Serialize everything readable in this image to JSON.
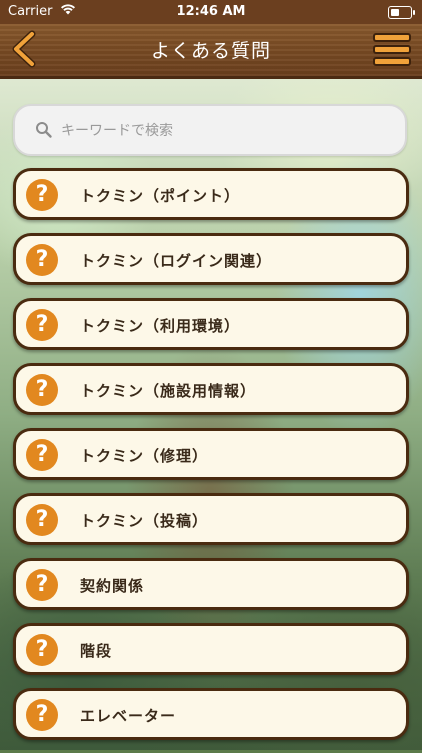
{
  "status_bar": {
    "carrier": "Carrier",
    "time": "12:46 AM"
  },
  "header": {
    "title": "よくある質問"
  },
  "search": {
    "placeholder": "キーワードで検索",
    "value": ""
  },
  "faq_items": [
    {
      "label": "トクミン（ポイント）"
    },
    {
      "label": "トクミン（ログイン関連）"
    },
    {
      "label": "トクミン（利用環境）"
    },
    {
      "label": "トクミン（施設用情報）"
    },
    {
      "label": "トクミン（修理）"
    },
    {
      "label": "トクミン（投稿）"
    },
    {
      "label": "契約関係"
    },
    {
      "label": "階段"
    },
    {
      "label": "エレベーター"
    }
  ],
  "icons": {
    "question": "?",
    "question_icon_color": "#e2881f",
    "accent_brown": "#6b3f1d"
  }
}
